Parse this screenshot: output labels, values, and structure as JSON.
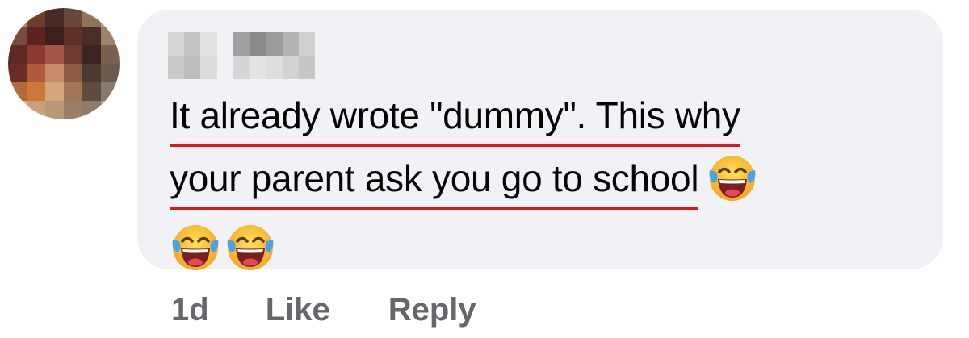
{
  "comment": {
    "line1": "It already wrote \"dummy\". This why",
    "line2": "your parent ask you go to school",
    "emoji": "face-with-tears-of-joy",
    "trailing_emoji_count": 2
  },
  "actions": {
    "time": "1d",
    "like": "Like",
    "reply": "Reply"
  },
  "colors": {
    "bubble": "#f0f2f5",
    "text": "#050505",
    "action_text": "#65676b",
    "underline": "#e0161e"
  }
}
